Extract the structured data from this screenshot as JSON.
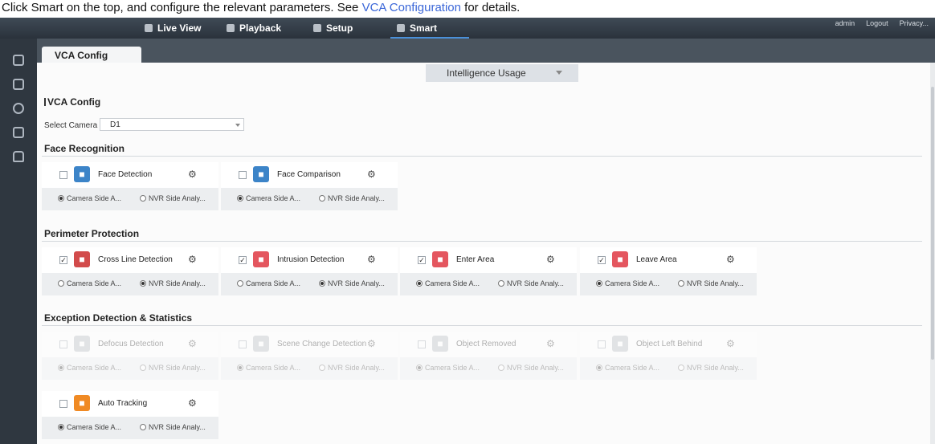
{
  "doc": {
    "text": "Click Smart on the top, and configure the relevant parameters. See ",
    "link": "VCA Configuration",
    "tail": " for details."
  },
  "topbar": {
    "nav": [
      "Live View",
      "Playback",
      "Setup",
      "Smart"
    ],
    "active": "Smart",
    "user": "admin",
    "logout": "Logout",
    "privacy": "Privacy..."
  },
  "sidebar": {
    "icons": [
      "vca-config-icon",
      "face-library-icon",
      "search-icon",
      "report-icon",
      "vehicle-icon"
    ]
  },
  "tab": "VCA Config",
  "intelligence_usage": "Intelligence Usage",
  "section_title": "VCA Config",
  "select_camera": {
    "label": "Select Camera",
    "value": "D1"
  },
  "groups": [
    {
      "title": "Face Recognition",
      "cards": [
        {
          "name": "Face Detection",
          "checked": false,
          "icon": "face-detection-icon",
          "color": "blue",
          "opt1": "Camera Side A...",
          "opt2": "NVR Side Analy...",
          "selected": 1,
          "disabled": false
        },
        {
          "name": "Face Comparison",
          "checked": false,
          "icon": "face-comparison-icon",
          "color": "blue",
          "opt1": "Camera Side A...",
          "opt2": "NVR Side Analy...",
          "selected": 1,
          "disabled": false
        }
      ]
    },
    {
      "title": "Perimeter Protection",
      "cards": [
        {
          "name": "Cross Line Detection",
          "checked": true,
          "icon": "cross-line-icon",
          "color": "red",
          "opt1": "Camera Side A...",
          "opt2": "NVR Side Analy...",
          "selected": 2,
          "disabled": false
        },
        {
          "name": "Intrusion Detection",
          "checked": true,
          "icon": "intrusion-icon",
          "color": "pink",
          "opt1": "Camera Side A...",
          "opt2": "NVR Side Analy...",
          "selected": 2,
          "disabled": false
        },
        {
          "name": "Enter Area",
          "checked": true,
          "icon": "enter-area-icon",
          "color": "pink",
          "opt1": "Camera Side A...",
          "opt2": "NVR Side Analy...",
          "selected": 1,
          "disabled": false
        },
        {
          "name": "Leave Area",
          "checked": true,
          "icon": "leave-area-icon",
          "color": "pink",
          "opt1": "Camera Side A...",
          "opt2": "NVR Side Analy...",
          "selected": 1,
          "disabled": false
        }
      ]
    },
    {
      "title": "Exception Detection & Statistics",
      "cards": [
        {
          "name": "Defocus Detection",
          "checked": false,
          "icon": "defocus-icon",
          "color": "gray",
          "opt1": "Camera Side A...",
          "opt2": "NVR Side Analy...",
          "selected": 1,
          "disabled": true
        },
        {
          "name": "Scene Change Detection",
          "checked": false,
          "icon": "scene-change-icon",
          "color": "gray",
          "opt1": "Camera Side A...",
          "opt2": "NVR Side Analy...",
          "selected": 1,
          "disabled": true
        },
        {
          "name": "Object Removed",
          "checked": false,
          "icon": "object-removed-icon",
          "color": "gray",
          "opt1": "Camera Side A...",
          "opt2": "NVR Side Analy...",
          "selected": 1,
          "disabled": true
        },
        {
          "name": "Object Left Behind",
          "checked": false,
          "icon": "object-left-icon",
          "color": "gray",
          "opt1": "Camera Side A...",
          "opt2": "NVR Side Analy...",
          "selected": 1,
          "disabled": true
        },
        {
          "name": "Auto Tracking",
          "checked": false,
          "icon": "auto-tracking-icon",
          "color": "orange",
          "opt1": "Camera Side A...",
          "opt2": "NVR Side Analy...",
          "selected": 1,
          "disabled": false
        }
      ]
    }
  ]
}
